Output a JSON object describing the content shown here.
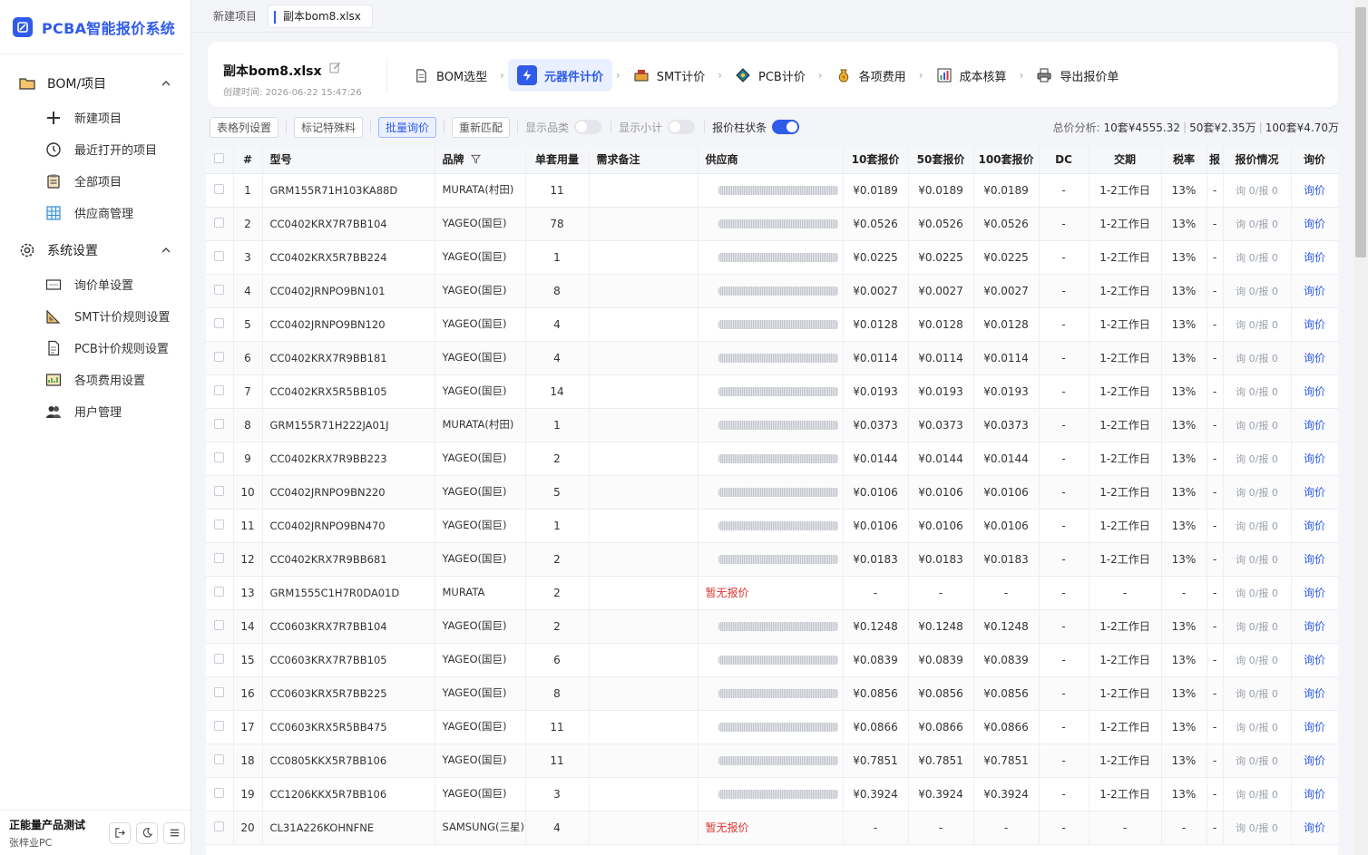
{
  "app": {
    "title": "PCBA智能报价系统"
  },
  "sidebar": {
    "groups": [
      {
        "label": "BOM/项目",
        "items": [
          {
            "label": "新建项目",
            "icon": "plus-icon"
          },
          {
            "label": "最近打开的项目",
            "icon": "clock-icon"
          },
          {
            "label": "全部项目",
            "icon": "clipboard-icon"
          },
          {
            "label": "供应商管理",
            "icon": "grid-icon"
          }
        ]
      },
      {
        "label": "系统设置",
        "items": [
          {
            "label": "询价单设置",
            "icon": "form-icon"
          },
          {
            "label": "SMT计价规则设置",
            "icon": "ruler-icon"
          },
          {
            "label": "PCB计价规则设置",
            "icon": "document-icon"
          },
          {
            "label": "各项费用设置",
            "icon": "chart-icon"
          },
          {
            "label": "用户管理",
            "icon": "users-icon"
          }
        ]
      }
    ],
    "user": {
      "name": "正能量产品测试",
      "sub": "张梓业PC"
    }
  },
  "tabs": {
    "t1": "新建项目",
    "t2": "副本bom8.xlsx"
  },
  "header": {
    "file_title": "副本bom8.xlsx",
    "created": "创建时间: 2026-06-22 15:47:26",
    "steps": [
      {
        "label": "BOM选型",
        "icon": "document-icon"
      },
      {
        "label": "元器件计价",
        "icon": "lightning-icon"
      },
      {
        "label": "SMT计价",
        "icon": "smt-icon"
      },
      {
        "label": "PCB计价",
        "icon": "pcb-icon"
      },
      {
        "label": "各项费用",
        "icon": "money-bag-icon"
      },
      {
        "label": "成本核算",
        "icon": "bar-chart-icon"
      },
      {
        "label": "导出报价单",
        "icon": "printer-icon"
      }
    ],
    "active_step": 1
  },
  "toolbar": {
    "col_settings": "表格列设置",
    "mark_special": "标记特殊料",
    "batch_inquiry": "批量询价",
    "rematch": "重新匹配",
    "show_category": "显示品类",
    "show_subtotal": "显示小计",
    "price_bar": "报价柱状条",
    "summary_label": "总价分析:",
    "sum10": "10套¥4555.32",
    "sum50": "50套¥2.35万",
    "sum100": "100套¥4.70万"
  },
  "table": {
    "headers": {
      "num": "#",
      "model": "型号",
      "brand": "品牌",
      "qty": "单套用量",
      "note": "需求备注",
      "supplier": "供应商",
      "p10": "10套报价",
      "p50": "50套报价",
      "p100": "100套报价",
      "dc": "DC",
      "lead": "交期",
      "tax": "税率",
      "extra": "报",
      "status": "报价情况",
      "action": "询价"
    },
    "rows": [
      {
        "n": "1",
        "model": "GRM155R71H103KA88D",
        "brand": "MURATA(村田)",
        "qty": "11",
        "q": true,
        "p10": "¥0.0189",
        "p50": "¥0.0189",
        "p100": "¥0.0189",
        "dc": "-",
        "lead": "1-2工作日",
        "tax": "13%",
        "extra": "-",
        "status": "询 0/报 0",
        "action": "询价"
      },
      {
        "n": "2",
        "model": "CC0402KRX7R7BB104",
        "brand": "YAGEO(国巨)",
        "qty": "78",
        "q": true,
        "p10": "¥0.0526",
        "p50": "¥0.0526",
        "p100": "¥0.0526",
        "dc": "-",
        "lead": "1-2工作日",
        "tax": "13%",
        "extra": "-",
        "status": "询 0/报 0",
        "action": "询价"
      },
      {
        "n": "3",
        "model": "CC0402KRX5R7BB224",
        "brand": "YAGEO(国巨)",
        "qty": "1",
        "q": true,
        "p10": "¥0.0225",
        "p50": "¥0.0225",
        "p100": "¥0.0225",
        "dc": "-",
        "lead": "1-2工作日",
        "tax": "13%",
        "extra": "-",
        "status": "询 0/报 0",
        "action": "询价"
      },
      {
        "n": "4",
        "model": "CC0402JRNPO9BN101",
        "brand": "YAGEO(国巨)",
        "qty": "8",
        "q": true,
        "p10": "¥0.0027",
        "p50": "¥0.0027",
        "p100": "¥0.0027",
        "dc": "-",
        "lead": "1-2工作日",
        "tax": "13%",
        "extra": "-",
        "status": "询 0/报 0",
        "action": "询价"
      },
      {
        "n": "5",
        "model": "CC0402JRNPO9BN120",
        "brand": "YAGEO(国巨)",
        "qty": "4",
        "q": true,
        "p10": "¥0.0128",
        "p50": "¥0.0128",
        "p100": "¥0.0128",
        "dc": "-",
        "lead": "1-2工作日",
        "tax": "13%",
        "extra": "-",
        "status": "询 0/报 0",
        "action": "询价"
      },
      {
        "n": "6",
        "model": "CC0402KRX7R9BB181",
        "brand": "YAGEO(国巨)",
        "qty": "4",
        "q": true,
        "p10": "¥0.0114",
        "p50": "¥0.0114",
        "p100": "¥0.0114",
        "dc": "-",
        "lead": "1-2工作日",
        "tax": "13%",
        "extra": "-",
        "status": "询 0/报 0",
        "action": "询价"
      },
      {
        "n": "7",
        "model": "CC0402KRX5R5BB105",
        "brand": "YAGEO(国巨)",
        "qty": "14",
        "q": true,
        "p10": "¥0.0193",
        "p50": "¥0.0193",
        "p100": "¥0.0193",
        "dc": "-",
        "lead": "1-2工作日",
        "tax": "13%",
        "extra": "-",
        "status": "询 0/报 0",
        "action": "询价"
      },
      {
        "n": "8",
        "model": "GRM155R71H222JA01J",
        "brand": "MURATA(村田)",
        "qty": "1",
        "q": true,
        "p10": "¥0.0373",
        "p50": "¥0.0373",
        "p100": "¥0.0373",
        "dc": "-",
        "lead": "1-2工作日",
        "tax": "13%",
        "extra": "-",
        "status": "询 0/报 0",
        "action": "询价"
      },
      {
        "n": "9",
        "model": "CC0402KRX7R9BB223",
        "brand": "YAGEO(国巨)",
        "qty": "2",
        "q": true,
        "p10": "¥0.0144",
        "p50": "¥0.0144",
        "p100": "¥0.0144",
        "dc": "-",
        "lead": "1-2工作日",
        "tax": "13%",
        "extra": "-",
        "status": "询 0/报 0",
        "action": "询价"
      },
      {
        "n": "10",
        "model": "CC0402JRNPO9BN220",
        "brand": "YAGEO(国巨)",
        "qty": "5",
        "q": true,
        "p10": "¥0.0106",
        "p50": "¥0.0106",
        "p100": "¥0.0106",
        "dc": "-",
        "lead": "1-2工作日",
        "tax": "13%",
        "extra": "-",
        "status": "询 0/报 0",
        "action": "询价"
      },
      {
        "n": "11",
        "model": "CC0402JRNPO9BN470",
        "brand": "YAGEO(国巨)",
        "qty": "1",
        "q": true,
        "p10": "¥0.0106",
        "p50": "¥0.0106",
        "p100": "¥0.0106",
        "dc": "-",
        "lead": "1-2工作日",
        "tax": "13%",
        "extra": "-",
        "status": "询 0/报 0",
        "action": "询价"
      },
      {
        "n": "12",
        "model": "CC0402KRX7R9BB681",
        "brand": "YAGEO(国巨)",
        "qty": "2",
        "q": true,
        "p10": "¥0.0183",
        "p50": "¥0.0183",
        "p100": "¥0.0183",
        "dc": "-",
        "lead": "1-2工作日",
        "tax": "13%",
        "extra": "-",
        "status": "询 0/报 0",
        "action": "询价"
      },
      {
        "n": "13",
        "model": "GRM1555C1H7R0DA01D",
        "brand": "MURATA",
        "qty": "2",
        "q": false,
        "noquote": "暂无报价",
        "p10": "-",
        "p50": "-",
        "p100": "-",
        "dc": "-",
        "lead": "-",
        "tax": "-",
        "extra": "-",
        "status": "询 0/报 0",
        "action": "询价"
      },
      {
        "n": "14",
        "model": "CC0603KRX7R7BB104",
        "brand": "YAGEO(国巨)",
        "qty": "2",
        "q": true,
        "p10": "¥0.1248",
        "p50": "¥0.1248",
        "p100": "¥0.1248",
        "dc": "-",
        "lead": "1-2工作日",
        "tax": "13%",
        "extra": "-",
        "status": "询 0/报 0",
        "action": "询价"
      },
      {
        "n": "15",
        "model": "CC0603KRX7R7BB105",
        "brand": "YAGEO(国巨)",
        "qty": "6",
        "q": true,
        "p10": "¥0.0839",
        "p50": "¥0.0839",
        "p100": "¥0.0839",
        "dc": "-",
        "lead": "1-2工作日",
        "tax": "13%",
        "extra": "-",
        "status": "询 0/报 0",
        "action": "询价"
      },
      {
        "n": "16",
        "model": "CC0603KRX5R7BB225",
        "brand": "YAGEO(国巨)",
        "qty": "8",
        "q": true,
        "p10": "¥0.0856",
        "p50": "¥0.0856",
        "p100": "¥0.0856",
        "dc": "-",
        "lead": "1-2工作日",
        "tax": "13%",
        "extra": "-",
        "status": "询 0/报 0",
        "action": "询价"
      },
      {
        "n": "17",
        "model": "CC0603KRX5R5BB475",
        "brand": "YAGEO(国巨)",
        "qty": "11",
        "q": true,
        "p10": "¥0.0866",
        "p50": "¥0.0866",
        "p100": "¥0.0866",
        "dc": "-",
        "lead": "1-2工作日",
        "tax": "13%",
        "extra": "-",
        "status": "询 0/报 0",
        "action": "询价"
      },
      {
        "n": "18",
        "model": "CC0805KKX5R7BB106",
        "brand": "YAGEO(国巨)",
        "qty": "11",
        "q": true,
        "p10": "¥0.7851",
        "p50": "¥0.7851",
        "p100": "¥0.7851",
        "dc": "-",
        "lead": "1-2工作日",
        "tax": "13%",
        "extra": "-",
        "status": "询 0/报 0",
        "action": "询价"
      },
      {
        "n": "19",
        "model": "CC1206KKX5R7BB106",
        "brand": "YAGEO(国巨)",
        "qty": "3",
        "q": true,
        "p10": "¥0.3924",
        "p50": "¥0.3924",
        "p100": "¥0.3924",
        "dc": "-",
        "lead": "1-2工作日",
        "tax": "13%",
        "extra": "-",
        "status": "询 0/报 0",
        "action": "询价"
      },
      {
        "n": "20",
        "model": "CL31A226KOHNFNE",
        "brand": "SAMSUNG(三星)",
        "qty": "4",
        "q": false,
        "noquote": "暂无报价",
        "p10": "-",
        "p50": "-",
        "p100": "-",
        "dc": "-",
        "lead": "-",
        "tax": "-",
        "extra": "-",
        "status": "询 0/报 0",
        "action": "询价"
      }
    ]
  },
  "colors": {
    "accent": "#2f5bea",
    "danger": "#e0332f"
  }
}
